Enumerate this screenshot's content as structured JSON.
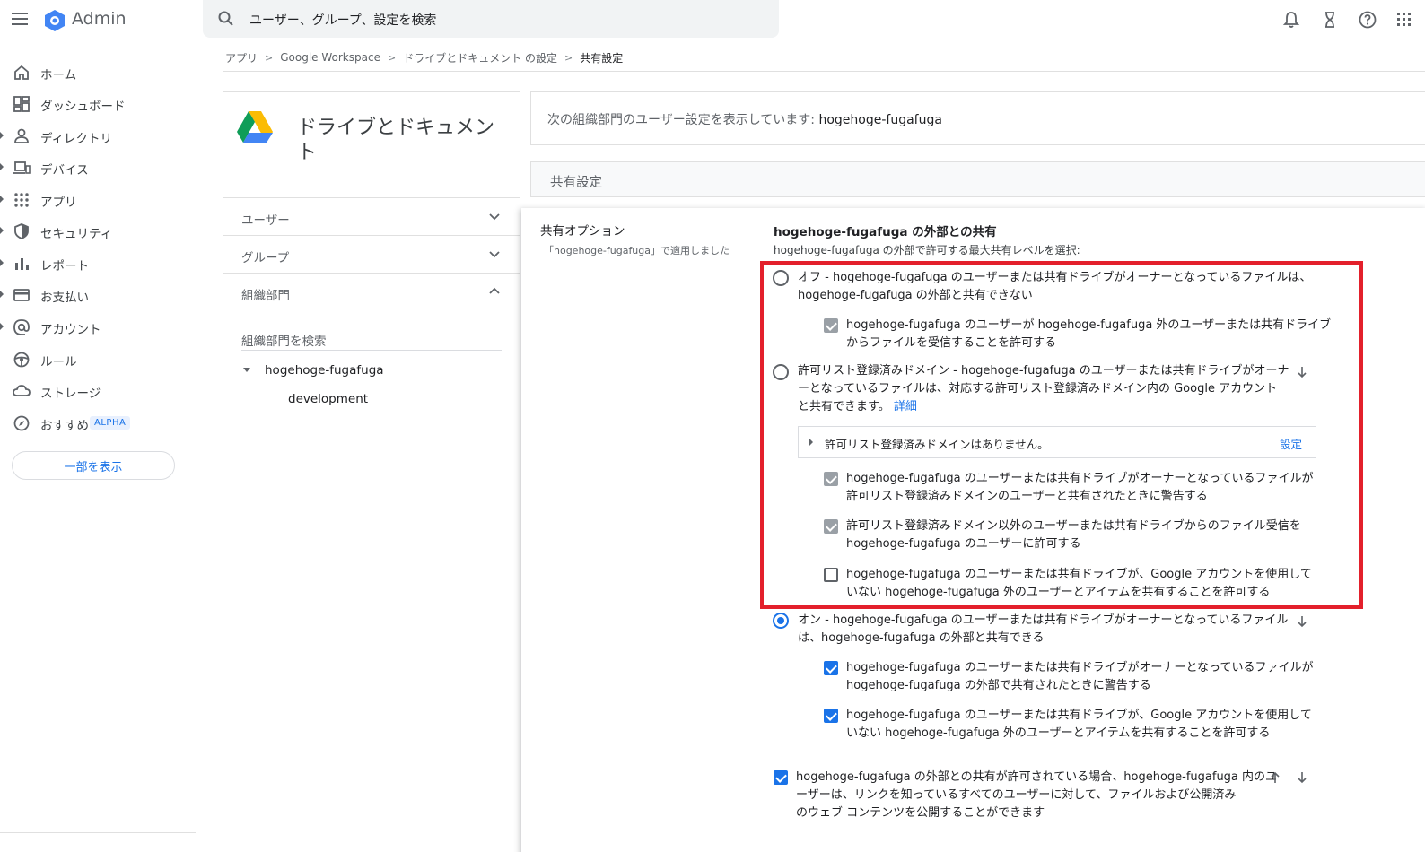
{
  "topbar": {
    "app_name": "Admin",
    "search_placeholder": "ユーザー、グループ、設定を検索"
  },
  "breadcrumb": [
    "アプリ",
    "Google Workspace",
    "ドライブとドキュメント の設定",
    "共有設定"
  ],
  "nav": {
    "items": [
      {
        "label": "ホーム",
        "icon": "home-icon"
      },
      {
        "label": "ダッシュボード",
        "icon": "dashboard-icon"
      },
      {
        "label": "ディレクトリ",
        "icon": "person-icon"
      },
      {
        "label": "デバイス",
        "icon": "devices-icon"
      },
      {
        "label": "アプリ",
        "icon": "apps-grid-icon"
      },
      {
        "label": "セキュリティ",
        "icon": "shield-icon"
      },
      {
        "label": "レポート",
        "icon": "bar-chart-icon"
      },
      {
        "label": "お支払い",
        "icon": "credit-card-icon"
      },
      {
        "label": "アカウント",
        "icon": "at-sign-icon"
      },
      {
        "label": "ルール",
        "icon": "rule-icon"
      },
      {
        "label": "ストレージ",
        "icon": "cloud-icon"
      },
      {
        "label": "おすすめ",
        "icon": "compass-icon"
      }
    ],
    "alpha_badge": "ALPHA",
    "show_less": "一部を表示"
  },
  "app_panel": {
    "title": "ドライブとドキュメント",
    "rows": [
      "ユーザー",
      "グループ",
      "組織部門"
    ],
    "org_search_placeholder": "組織部門を検索",
    "org_root": "hogehoge-fugafuga",
    "org_child": "development"
  },
  "ou_header": {
    "prefix": "次の組織部門のユーザー設定を表示しています: ",
    "name": "hogehoge-fugafuga"
  },
  "section_title": "共有設定",
  "card": {
    "option_title": "共有オプション",
    "option_sub": "「hogehoge-fugafuga」で適用しました",
    "ext_title": "hogehoge-fugafuga の外部との共有",
    "ext_sub": "hogehoge-fugafuga の外部で許可する最大共有レベルを選択:",
    "off_line1": "オフ - hogehoge-fugafuga のユーザーまたは共有ドライブがオーナーとなっているファイルは、",
    "off_line2": "hogehoge-fugafuga の外部と共有できない",
    "off_cb1_line1": "hogehoge-fugafuga のユーザーが hogehoge-fugafuga 外のユーザーまたは共有ドライブ",
    "off_cb1_line2": "からファイルを受信することを許可する",
    "allow_line1": "許可リスト登録済みドメイン - hogehoge-fugafuga のユーザーまたは共有ドライブがオーナ",
    "allow_line2": "ーとなっているファイルは、対応する許可リスト登録済みドメイン内の Google アカウント",
    "allow_line3": "と共有できます。",
    "allow_detail": "詳細",
    "allow_box_text": "許可リスト登録済みドメインはありません。",
    "allow_box_link": "設定",
    "allow_cb1_line1": "hogehoge-fugafuga のユーザーまたは共有ドライブがオーナーとなっているファイルが",
    "allow_cb1_line2": "許可リスト登録済みドメインのユーザーと共有されたときに警告する",
    "allow_cb2_line1": "許可リスト登録済みドメイン以外のユーザーまたは共有ドライブからのファイル受信を",
    "allow_cb2_line2": "hogehoge-fugafuga のユーザーに許可する",
    "allow_cb3_line1": "hogehoge-fugafuga のユーザーまたは共有ドライブが、Google アカウントを使用して",
    "allow_cb3_line2": "いない hogehoge-fugafuga 外のユーザーとアイテムを共有することを許可する",
    "on_line1": "オン - hogehoge-fugafuga のユーザーまたは共有ドライブがオーナーとなっているファイル",
    "on_line2": "は、hogehoge-fugafuga の外部と共有できる",
    "on_cb1_line1": "hogehoge-fugafuga のユーザーまたは共有ドライブがオーナーとなっているファイルが",
    "on_cb1_line2": "hogehoge-fugafuga の外部で共有されたときに警告する",
    "on_cb2_line1": "hogehoge-fugafuga のユーザーまたは共有ドライブが、Google アカウントを使用して",
    "on_cb2_line2": "いない hogehoge-fugafuga 外のユーザーとアイテムを共有することを許可する",
    "publish_line1": "hogehoge-fugafuga の外部との共有が許可されている場合、hogehoge-fugafuga 内のユ",
    "publish_line2": "ーザーは、リンクを知っているすべてのユーザーに対して、ファイルおよび公開済み",
    "publish_line3": "のウェブ コンテンツを公開することができます"
  },
  "colors": {
    "accent": "#1a73e8",
    "highlight": "#e3202b",
    "checkbox_disabled": "#9aa0a6"
  }
}
